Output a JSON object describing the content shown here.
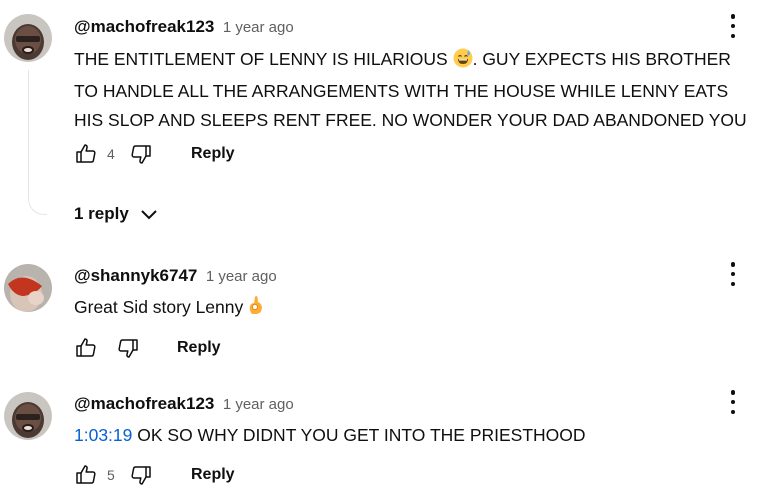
{
  "comments": [
    {
      "handle": "@machofreak123",
      "time": "1 year ago",
      "text_before_emoji": "THE ENTITLEMENT OF LENNY IS HILARIOUS ",
      "text_after_emoji": ". GUY EXPECTS HIS BROTHER TO HANDLE ALL THE ARRANGEMENTS WITH THE HOUSE WHILE LENNY EATS HIS SLOP AND SLEEPS RENT FREE. NO WONDER YOUR DAD ABANDONED YOU",
      "emoji": "grinning-sweat-emoji",
      "likes": "4",
      "reply_label": "Reply",
      "replies_label": "1 reply"
    },
    {
      "handle": "@shannyk6747",
      "time": "1 year ago",
      "text": "Great Sid story Lenny ",
      "emoji": "ok-hand-emoji",
      "likes": "",
      "reply_label": "Reply"
    },
    {
      "handle": "@machofreak123",
      "time": "1 year ago",
      "timestamp_link": "1:03:19",
      "text": " OK SO WHY DIDNT YOU GET INTO THE PRIESTHOOD",
      "likes": "5",
      "reply_label": "Reply"
    }
  ],
  "icons": {
    "like": "thumbs-up-icon",
    "dislike": "thumbs-down-icon",
    "menu": "more-vert-icon",
    "expand": "chevron-down-icon"
  },
  "colors": {
    "link": "#065fd4",
    "meta": "#606060",
    "text": "#0f0f0f"
  }
}
